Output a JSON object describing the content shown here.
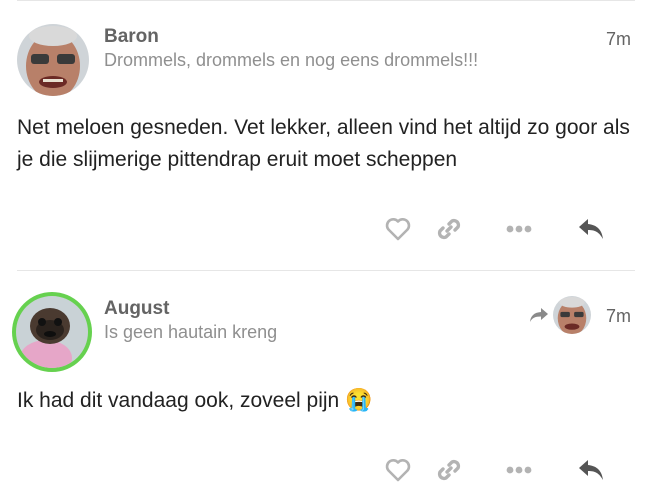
{
  "posts": [
    {
      "username": "Baron",
      "user_title": "Drommels, drommels en nog eens drommels!!!",
      "time": "7m",
      "body": "Net meloen gesneden. Vet lekker, alleen vind het altijd zo goor als je die slijmerige pittendrap eruit moet scheppen",
      "avatar": "avatar-grumpy-man"
    },
    {
      "username": "August",
      "user_title": "Is geen hautain kreng",
      "time": "7m",
      "body": "Ik had dit vandaag ook, zoveel pijn",
      "emoji": "😭",
      "avatar": "avatar-pug-in-pink-sweater",
      "avatar_ring_color": "#66d14f",
      "reply_to_avatar": "avatar-grumpy-man"
    }
  ],
  "actions": [
    "heart-icon",
    "link-icon",
    "more-icon",
    "reply-icon"
  ],
  "colors": {
    "icon": "#b3b3b3",
    "reply_icon": "#555555",
    "divider": "#e6e6e6"
  }
}
